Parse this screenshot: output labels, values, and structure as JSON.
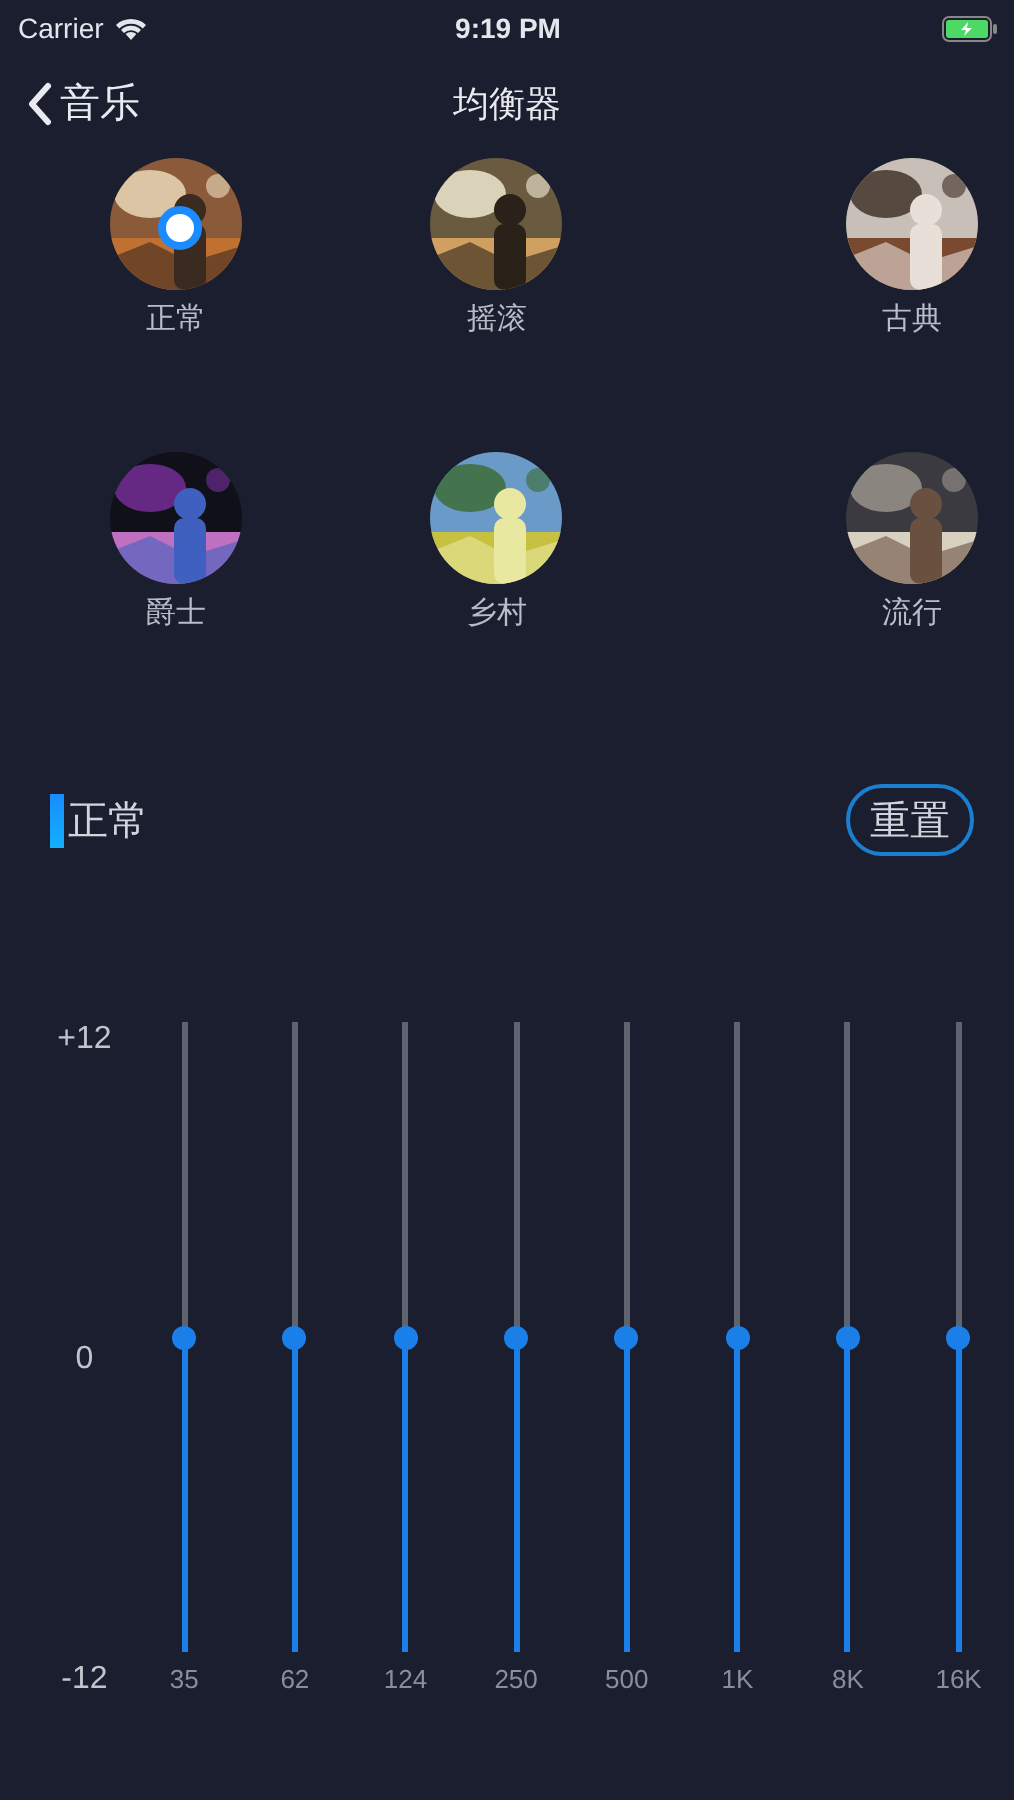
{
  "status_bar": {
    "carrier": "Carrier",
    "time": "9:19 PM"
  },
  "nav": {
    "back_label": "音乐",
    "title": "均衡器"
  },
  "presets": [
    {
      "label": "正常",
      "selected": true
    },
    {
      "label": "摇滚",
      "selected": false
    },
    {
      "label": "古典",
      "selected": false
    },
    {
      "label": "爵士",
      "selected": false
    },
    {
      "label": "乡村",
      "selected": false
    },
    {
      "label": "流行",
      "selected": false
    }
  ],
  "section": {
    "title": "正常",
    "reset_button": "重置"
  },
  "axis_labels": [
    "+12",
    "0",
    "-12"
  ],
  "bands": [
    {
      "label": "35",
      "level": 0.5
    },
    {
      "label": "62",
      "level": 0.5
    },
    {
      "label": "124",
      "level": 0.5
    },
    {
      "label": "250",
      "level": 0.5
    },
    {
      "label": "500",
      "level": 0.5
    },
    {
      "label": "1K",
      "level": 0.5
    },
    {
      "label": "8K",
      "level": 0.5
    },
    {
      "label": "16K",
      "level": 0.5
    }
  ]
}
